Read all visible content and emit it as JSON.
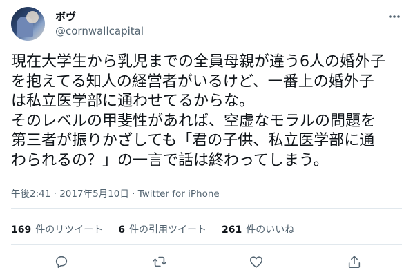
{
  "user": {
    "name": "ボヴ",
    "handle": "@cornwallcapital"
  },
  "tweet": {
    "text": "現在大学生から乳児までの全員母親が違う6人の婚外子\nを抱えてる知人の経営者がいるけど、一番上の婚外子\nは私立医学部に通わせてるからな。\nそのレベルの甲斐性があれば、空虚なモラルの問題を\n第三者が振りかざしても「君の子供、私立医学部に通\nわられるの？」の一言で話は終わってしまう。"
  },
  "meta": {
    "time": "午後2:41",
    "sep1": "·",
    "date": "2017年5月10日",
    "sep2": "·",
    "source": "Twitter for iPhone"
  },
  "stats": {
    "retweets_count": "169",
    "retweets_label": "件のリツイート",
    "quotes_count": "6",
    "quotes_label": "件の引用ツイート",
    "likes_count": "261",
    "likes_label": "件のいいね"
  },
  "icons": {
    "more": "more-icon",
    "reply": "reply-icon",
    "retweet": "retweet-icon",
    "like": "heart-icon",
    "share": "share-icon"
  },
  "colors": {
    "text": "#0f1419",
    "secondary": "#536471",
    "divider": "#e1e8ed"
  }
}
